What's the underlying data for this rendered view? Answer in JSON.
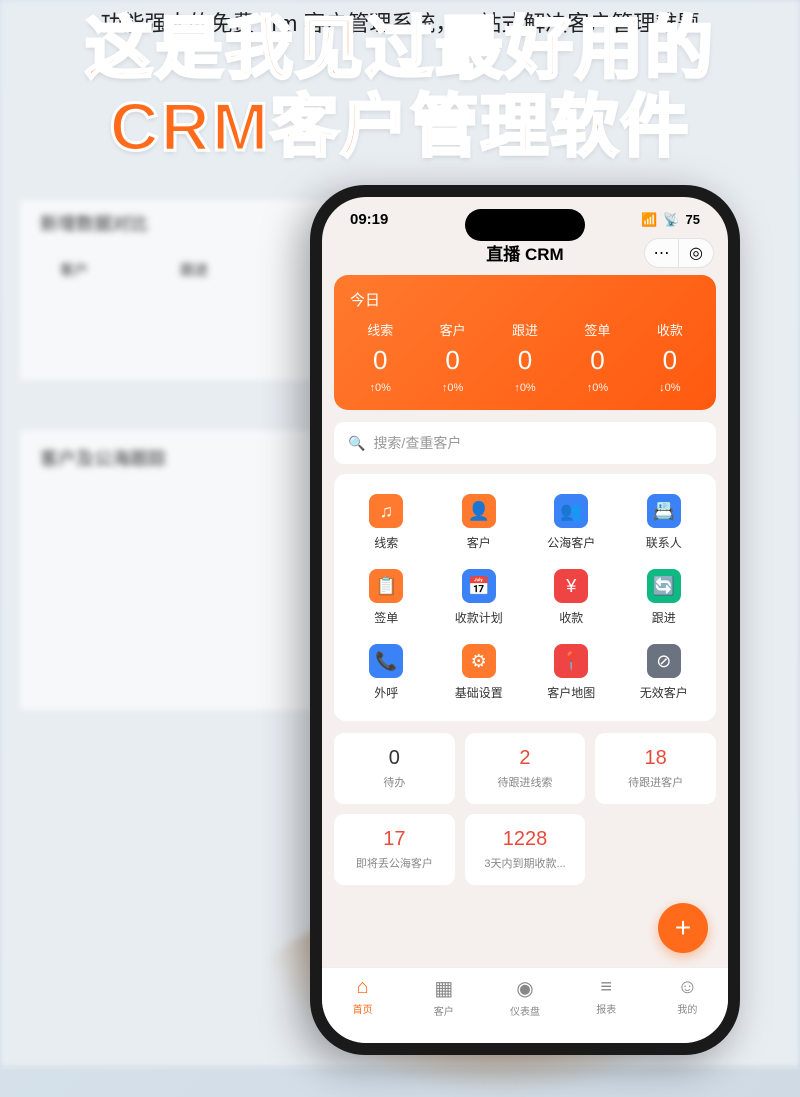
{
  "banner": "功能强大的免费 crm 客户管理系统，一站式解决客户管理难题",
  "hero": {
    "line1": "这是我见过最好用的",
    "line2": "CRM客户管理软件"
  },
  "bg": {
    "section1": "新增数据对比",
    "col1": "客户",
    "col2": "跟进",
    "section2": "客户及公海跟踪"
  },
  "status": {
    "time": "09:19",
    "battery": "75"
  },
  "app_title": "直播 CRM",
  "today": {
    "label": "今日",
    "stats": [
      {
        "label": "线索",
        "value": "0",
        "change": "↑0%"
      },
      {
        "label": "客户",
        "value": "0",
        "change": "↑0%"
      },
      {
        "label": "跟进",
        "value": "0",
        "change": "↑0%"
      },
      {
        "label": "签单",
        "value": "0",
        "change": "↑0%"
      },
      {
        "label": "收款",
        "value": "0",
        "change": "↓0%"
      }
    ]
  },
  "search": {
    "placeholder": "搜索/查重客户"
  },
  "grid": [
    {
      "label": "线索",
      "color": "#ff7a2e",
      "glyph": "♫"
    },
    {
      "label": "客户",
      "color": "#ff7a2e",
      "glyph": "👤"
    },
    {
      "label": "公海客户",
      "color": "#3b82f6",
      "glyph": "👥"
    },
    {
      "label": "联系人",
      "color": "#3b82f6",
      "glyph": "📇"
    },
    {
      "label": "签单",
      "color": "#ff7a2e",
      "glyph": "📋"
    },
    {
      "label": "收款计划",
      "color": "#3b82f6",
      "glyph": "📅"
    },
    {
      "label": "收款",
      "color": "#ef4444",
      "glyph": "¥"
    },
    {
      "label": "跟进",
      "color": "#10b981",
      "glyph": "🔄"
    },
    {
      "label": "外呼",
      "color": "#3b82f6",
      "glyph": "📞"
    },
    {
      "label": "基础设置",
      "color": "#ff7a2e",
      "glyph": "⚙"
    },
    {
      "label": "客户地图",
      "color": "#ef4444",
      "glyph": "📍"
    },
    {
      "label": "无效客户",
      "color": "#6b7280",
      "glyph": "⊘"
    }
  ],
  "tiles": [
    {
      "value": "0",
      "label": "待办",
      "red": false
    },
    {
      "value": "2",
      "label": "待跟进线索",
      "red": true
    },
    {
      "value": "18",
      "label": "待跟进客户",
      "red": true
    },
    {
      "value": "17",
      "label": "即将丢公海客户",
      "red": true
    },
    {
      "value": "1228",
      "label": "3天内到期收款...",
      "red": true
    }
  ],
  "fab": "+",
  "tabs": [
    {
      "label": "首页",
      "icon": "⌂",
      "active": true
    },
    {
      "label": "客户",
      "icon": "▦",
      "active": false
    },
    {
      "label": "仪表盘",
      "icon": "◉",
      "active": false
    },
    {
      "label": "报表",
      "icon": "≡",
      "active": false
    },
    {
      "label": "我的",
      "icon": "☺",
      "active": false
    }
  ]
}
